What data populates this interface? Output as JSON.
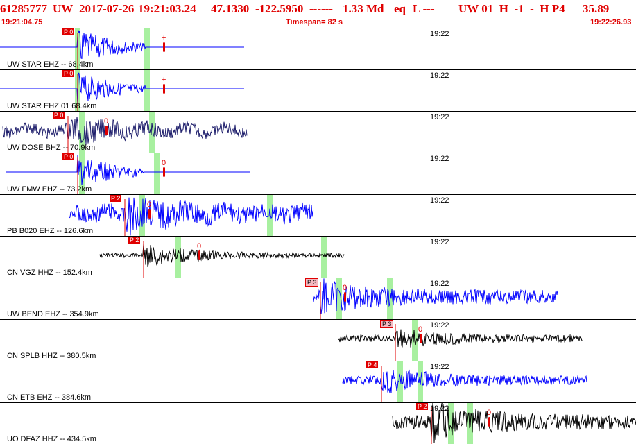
{
  "header": {
    "event_id": "61285777",
    "network": "UW",
    "date": "2017-07-26",
    "time": "19:21:03.24",
    "lat": "47.1330",
    "lon": "-122.5950",
    "dashes": "------",
    "magnitude": "1.33 Md",
    "event_type": "eq",
    "location_quality": "L ---",
    "station_info": "UW 01  H  -1  -  H P4",
    "depth": "35.89",
    "start_time": "19:21:04.75",
    "timespan": "Timespan=  82 s",
    "end_time": "19:22:26.93"
  },
  "colors": {
    "header_red": "#e00000",
    "trace_blue": "#0000ff",
    "trace_navy": "#1c1c6a",
    "trace_black": "#000000",
    "pick_red": "#e00000",
    "pick_pink": "#f4b8c0",
    "coda_green": "#a8f0a0"
  },
  "panels": [
    {
      "label": "UW STAR EHZ -- 68.4km",
      "time": "19:22",
      "pick": "P 0",
      "pick_style": "red",
      "marker": "+",
      "color": "blue"
    },
    {
      "label": "UW STAR EHZ 01 68.4km",
      "time": "19:22",
      "pick": "P 0",
      "pick_style": "red",
      "marker": "+",
      "color": "blue"
    },
    {
      "label": "UW DOSE BHZ -- 70.9km",
      "time": "19:22",
      "pick": "P 0",
      "pick_style": "red",
      "marker": "0",
      "color": "navy"
    },
    {
      "label": "UW FMW EHZ -- 73.2km",
      "time": "19:22",
      "pick": "P 0",
      "pick_style": "red",
      "marker": "0",
      "color": "blue"
    },
    {
      "label": "PB B020 EHZ -- 126.6km",
      "time": "19:22",
      "pick": "P 2",
      "pick_style": "red",
      "marker": "0",
      "color": "blue"
    },
    {
      "label": "CN VGZ HHZ -- 152.4km",
      "time": "19:22",
      "pick": "P 2",
      "pick_style": "red",
      "marker": "0",
      "color": "black"
    },
    {
      "label": "UW BEND EHZ -- 354.9km",
      "time": "19:22",
      "pick": "P 3",
      "pick_style": "pink",
      "marker": "0",
      "color": "blue"
    },
    {
      "label": "CN SPLB HHZ -- 380.5km",
      "time": "19:22",
      "pick": "P 3",
      "pick_style": "pink",
      "marker": "0",
      "color": "black"
    },
    {
      "label": "CN ETB EHZ -- 384.6km",
      "time": "19:22",
      "pick": "P 4",
      "pick_style": "red",
      "marker": "",
      "color": "blue"
    },
    {
      "label": "UO DFAZ HHZ -- 434.5km",
      "time": "19:22",
      "pick": "P 2",
      "pick_style": "red",
      "marker": "0",
      "color": "black"
    }
  ]
}
